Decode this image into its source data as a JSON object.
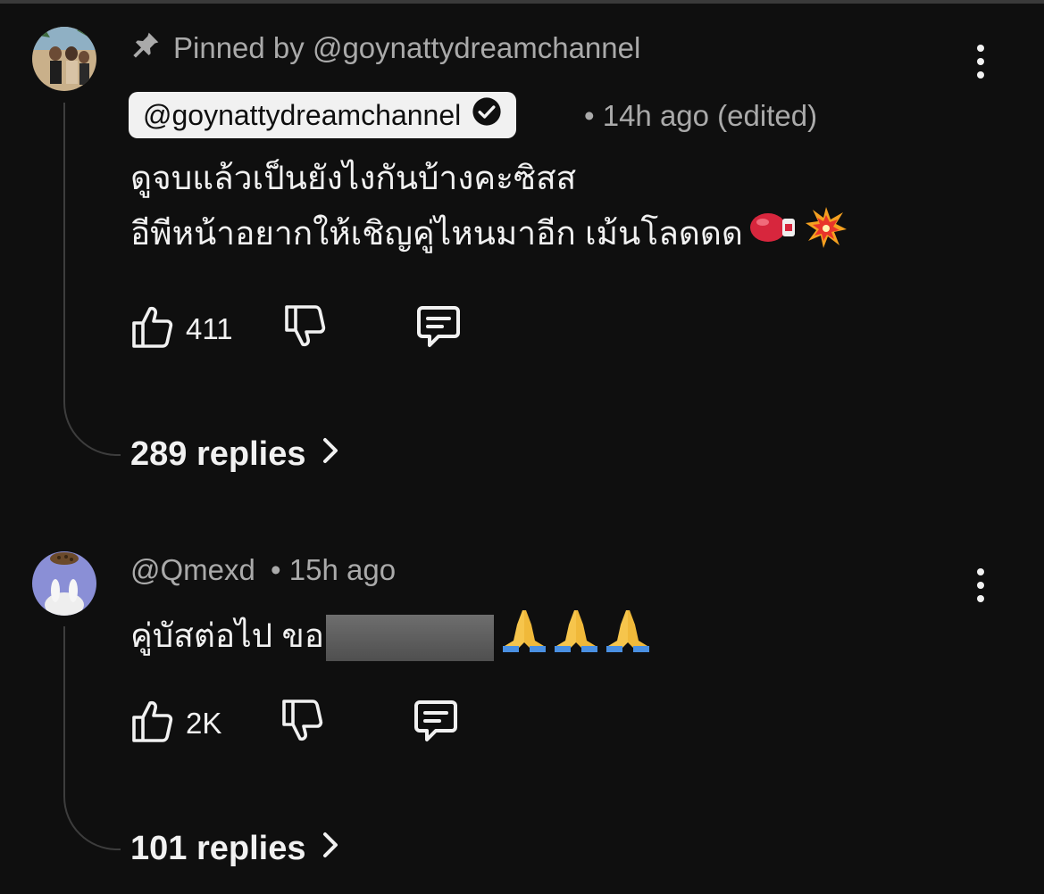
{
  "comments": [
    {
      "pinned_label": "Pinned by @goynattydreamchannel",
      "author": "@goynattydreamchannel",
      "timestamp": "• 14h ago (edited)",
      "text_line1": "ดูจบแล้วเป็นยังไงกันบ้างคะซิสส",
      "text_line2": "อีพีหน้าอยากให้เชิญคู่ไหนมาอีก เม้นโลดดด",
      "emoji_names": [
        "boxing-glove-emoji",
        "collision-emoji"
      ],
      "likes": "411",
      "replies_label": "289 replies"
    },
    {
      "author": "@Qmexd",
      "timestamp": "• 15h ago",
      "text_before": "คู่บัสต่อไป ขอ",
      "emoji_names": [
        "folded-hands-emoji",
        "folded-hands-emoji",
        "folded-hands-emoji"
      ],
      "likes": "2K",
      "replies_label": "101 replies"
    }
  ],
  "colors": {
    "background": "#0f0f0f",
    "primary_text": "#f1f1f1",
    "secondary_text": "#aaaaaa",
    "chip_bg": "#f1f1f1",
    "thread_line": "#3d3d3d"
  }
}
